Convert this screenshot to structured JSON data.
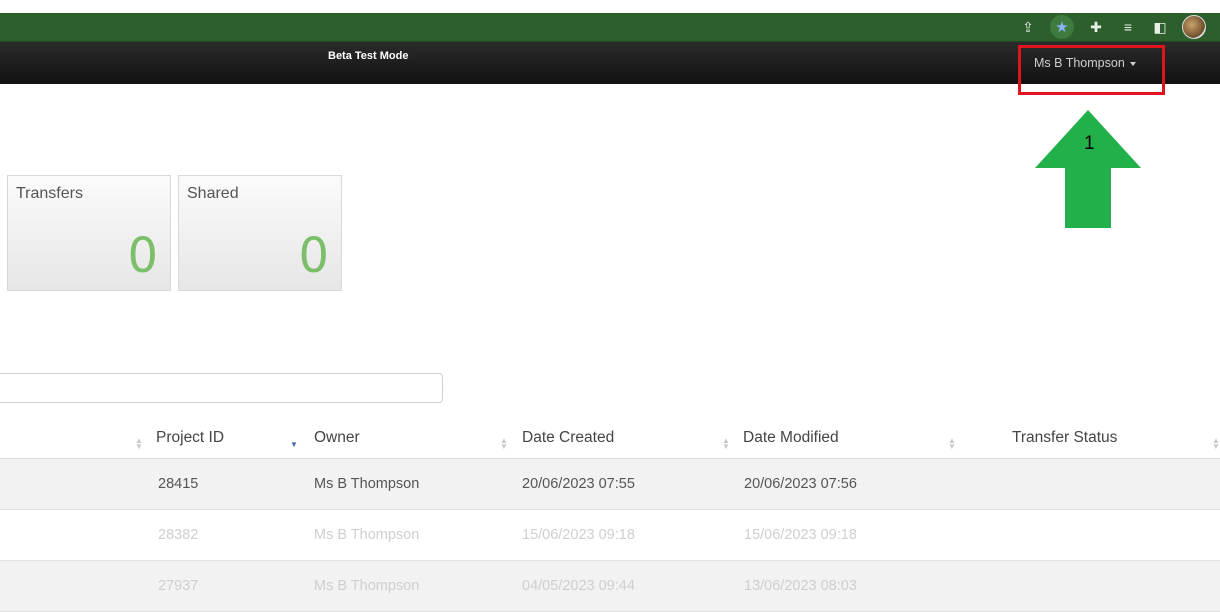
{
  "navbar": {
    "beta_label": "Beta Test Mode",
    "user_label": "Ms B Thompson"
  },
  "annotation": {
    "step_number": "1",
    "highlight_color": "#e0141e",
    "arrow_color": "#22b04a"
  },
  "tiles": [
    {
      "label": "Transfers",
      "count": "0"
    },
    {
      "label": "Shared",
      "count": "0"
    }
  ],
  "search": {
    "value": "",
    "placeholder": ""
  },
  "table": {
    "columns": [
      "Project ID",
      "Owner",
      "Date Created",
      "Date Modified",
      "Transfer Status"
    ],
    "rows": [
      {
        "project_id": "28415",
        "owner": "Ms B Thompson",
        "created": "20/06/2023 07:55",
        "modified": "20/06/2023 07:56",
        "status": ""
      },
      {
        "project_id": "28382",
        "owner": "Ms B Thompson",
        "created": "15/06/2023 09:18",
        "modified": "15/06/2023 09:18",
        "status": ""
      },
      {
        "project_id": "27937",
        "owner": "Ms B Thompson",
        "created": "04/05/2023 09:44",
        "modified": "13/06/2023 08:03",
        "status": ""
      }
    ]
  },
  "colors": {
    "browser_bar": "#2c5f2c",
    "navbar": "#1a1a1a",
    "tile_count": "#7cbf6b",
    "sort_active": "#4a67b0"
  }
}
